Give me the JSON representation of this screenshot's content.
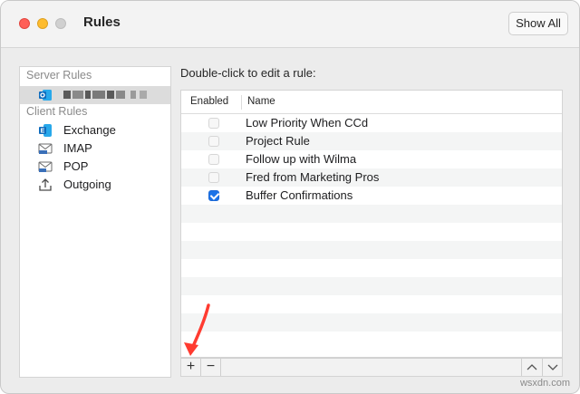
{
  "window": {
    "title": "Rules",
    "show_all_label": "Show All"
  },
  "sidebar": {
    "server_header": "Server Rules",
    "client_header": "Client Rules",
    "client_items": [
      {
        "label": "Exchange",
        "icon": "exchange-icon"
      },
      {
        "label": "IMAP",
        "icon": "imap-icon"
      },
      {
        "label": "POP",
        "icon": "pop-icon"
      },
      {
        "label": "Outgoing",
        "icon": "outgoing-icon"
      }
    ]
  },
  "main": {
    "instruction": "Double-click to edit a rule:",
    "columns": {
      "enabled": "Enabled",
      "name": "Name"
    },
    "rules": [
      {
        "name": "Low Priority When CCd",
        "enabled": false
      },
      {
        "name": "Project Rule",
        "enabled": false
      },
      {
        "name": "Follow up with Wilma",
        "enabled": false
      },
      {
        "name": "Fred from Marketing Pros",
        "enabled": false
      },
      {
        "name": "Buffer Confirmations",
        "enabled": true
      }
    ]
  },
  "bottombar": {
    "add": "+",
    "remove": "−",
    "up": "︿",
    "down": "﹀"
  },
  "watermark": "wsxdn.com",
  "colors": {
    "accent": "#1a73e8",
    "arrow": "#ff3b30",
    "outlook_blue": "#0f6cbd"
  }
}
